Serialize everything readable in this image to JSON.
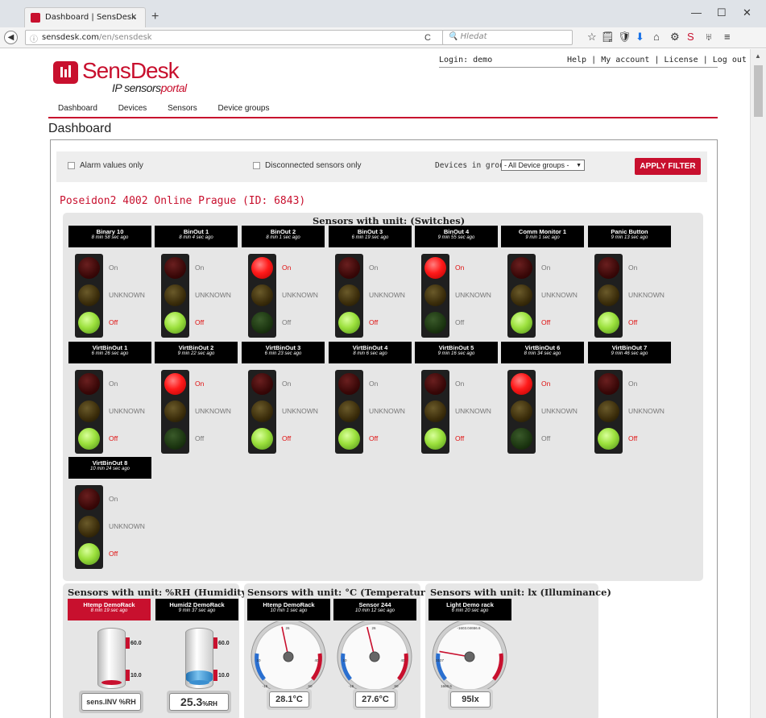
{
  "browser": {
    "tab_title": "Dashboard | SensDesk",
    "url_host": "sensdesk.com",
    "url_path": "/en/sensdesk",
    "search_placeholder": "Hledat",
    "close_tab": "×",
    "new_tab": "+",
    "minimize": "—",
    "maximize": "☐",
    "close_window": "✕",
    "back": "◀",
    "info": "ⓘ",
    "reload": "C",
    "search_icon": "🔍"
  },
  "toolbar_icons": [
    "☆",
    "🗒",
    "🛡",
    "⬇",
    "⌂",
    "⚙",
    "S",
    "♅",
    "≡"
  ],
  "header": {
    "login": "Login: demo",
    "help": "Help",
    "my_account": "My account",
    "license": "License",
    "logout": "Log out",
    "sep": "|",
    "logo_brand": "SensDesk",
    "logo_sub_prefix": "IP sensors",
    "logo_sub_suffix": "portal"
  },
  "nav": [
    "Dashboard",
    "Devices",
    "Sensors",
    "Device groups"
  ],
  "page_title": "Dashboard",
  "filters": {
    "alarm_only": "Alarm values only",
    "disconnected_only": "Disconnected sensors only",
    "group_label": "Devices in group:",
    "group_value": "- All Device groups -",
    "apply": "APPLY FILTER",
    "dropdown_arrow": "▼"
  },
  "device_title": "Poseidon2 4002 Online Prague (ID: 6843)",
  "switches": {
    "title": "Sensors with unit: (Switches)",
    "labels": {
      "on": "On",
      "unknown": "UNKNOWN",
      "off": "Off"
    },
    "sensors": [
      {
        "name": "Binary 10",
        "time": "8 min 58 sec ago",
        "state": "off"
      },
      {
        "name": "BinOut 1",
        "time": "8 min 4 sec ago",
        "state": "off"
      },
      {
        "name": "BinOut 2",
        "time": "8 min 1 sec ago",
        "state": "on"
      },
      {
        "name": "BinOut 3",
        "time": "6 min 19 sec ago",
        "state": "off"
      },
      {
        "name": "BinOut 4",
        "time": "9 min 55 sec ago",
        "state": "on"
      },
      {
        "name": "Comm Monitor 1",
        "time": "9 min 1 sec ago",
        "state": "off"
      },
      {
        "name": "Panic Button",
        "time": "9 min 13 sec ago",
        "state": "off"
      },
      {
        "name": "VirtBinOut 1",
        "time": "6 min 26 sec ago",
        "state": "off"
      },
      {
        "name": "VirtBinOut 2",
        "time": "9 min 22 sec ago",
        "state": "on"
      },
      {
        "name": "VirtBinOut 3",
        "time": "6 min 23 sec ago",
        "state": "off"
      },
      {
        "name": "VirtBinOut 4",
        "time": "8 min 6 sec ago",
        "state": "off"
      },
      {
        "name": "VirtBinOut 5",
        "time": "9 min 16 sec ago",
        "state": "off"
      },
      {
        "name": "VirtBinOut 6",
        "time": "8 min 34 sec ago",
        "state": "on"
      },
      {
        "name": "VirtBinOut 7",
        "time": "9 min 46 sec ago",
        "state": "off"
      },
      {
        "name": "VirtBinOut 8",
        "time": "10 min 24 sec ago",
        "state": "off"
      }
    ]
  },
  "humidity": {
    "title": "Sensors with unit: %RH (Humidity)",
    "sensors": [
      {
        "name": "Htemp DemoRack",
        "time": "8 min 19 sec ago",
        "alarm": true,
        "value": "sens.INV %RH",
        "hi": "60.0",
        "lo": "10.0",
        "fill": 0
      },
      {
        "name": "Humid2 DemoRack",
        "time": "9 min 37 sec ago",
        "alarm": false,
        "value": "25.3",
        "unit": "%RH",
        "hi": "60.0",
        "lo": "10.0",
        "fill": 0.25
      }
    ]
  },
  "temperature": {
    "title": "Sensors with unit: °C (Temperature)",
    "sensors": [
      {
        "name": "Htemp DemoRack",
        "time": "10 min 1 sec ago",
        "value": "28.1°C",
        "ticks": [
          "-15",
          "10",
          "26",
          "40",
          "60"
        ],
        "needle": -12
      },
      {
        "name": "Sensor 244",
        "time": "10 min 12 sec ago",
        "value": "27.6°C",
        "ticks": [
          "-15",
          "10",
          "26",
          "40",
          "60"
        ],
        "needle": -14
      }
    ]
  },
  "illuminance": {
    "title": "Sensors with unit: lx (Illuminance)",
    "sensors": [
      {
        "name": "Light Demo rack",
        "time": "6 min 20 sec ago",
        "value": "95lx",
        "ticks": [
          "1660.6",
          "3107",
          "-1603.04656.6"
        ],
        "needle": -80
      }
    ]
  },
  "colors": {
    "brand": "#c8102e",
    "on_red": "#ff1a1a",
    "off_green": "#9be03c"
  }
}
